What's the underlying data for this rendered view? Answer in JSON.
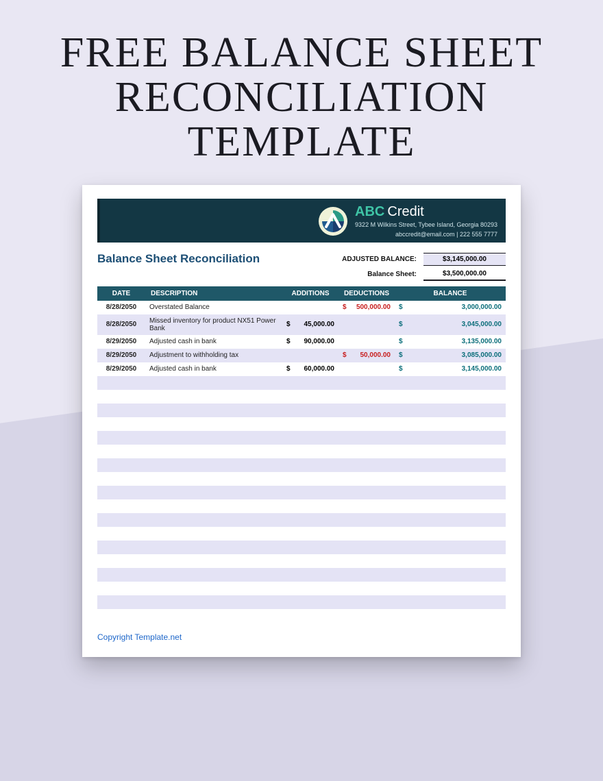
{
  "headline_l1": "FREE BALANCE SHEET",
  "headline_l2": "RECONCILIATION TEMPLATE",
  "brand": {
    "a": "ABC",
    "rest": "Credit"
  },
  "addr1": "9322 M Wilkins Street, Tybee Island, Georgia 80293",
  "addr2": "abccredit@email.com | 222 555 7777",
  "section_title": "Balance Sheet Reconciliation",
  "adj_label": "ADJUSTED BALANCE:",
  "adj_value": "$3,145,000.00",
  "bs_label": "Balance Sheet:",
  "bs_value": "$3,500,000.00",
  "cols": {
    "date": "DATE",
    "desc": "DESCRIPTION",
    "add": "ADDITIONS",
    "ded": "DEDUCTIONS",
    "bal": "BALANCE"
  },
  "rows": [
    {
      "date": "8/28/2050",
      "desc": "Overstated Balance",
      "add": "",
      "ded": "500,000.00",
      "bal": "3,000,000.00"
    },
    {
      "date": "8/28/2050",
      "desc": "Missed inventory for product NX51 Power Bank",
      "add": "45,000.00",
      "ded": "",
      "bal": "3,045,000.00"
    },
    {
      "date": "8/29/2050",
      "desc": "Adjusted cash in bank",
      "add": "90,000.00",
      "ded": "",
      "bal": "3,135,000.00"
    },
    {
      "date": "8/29/2050",
      "desc": "Adjustment to withholding tax",
      "add": "",
      "ded": "50,000.00",
      "bal": "3,085,000.00"
    },
    {
      "date": "8/29/2050",
      "desc": "Adjusted cash in bank",
      "add": "60,000.00",
      "ded": "",
      "bal": "3,145,000.00"
    }
  ],
  "empty_rows": 18,
  "copyright": "Copyright Template.net"
}
